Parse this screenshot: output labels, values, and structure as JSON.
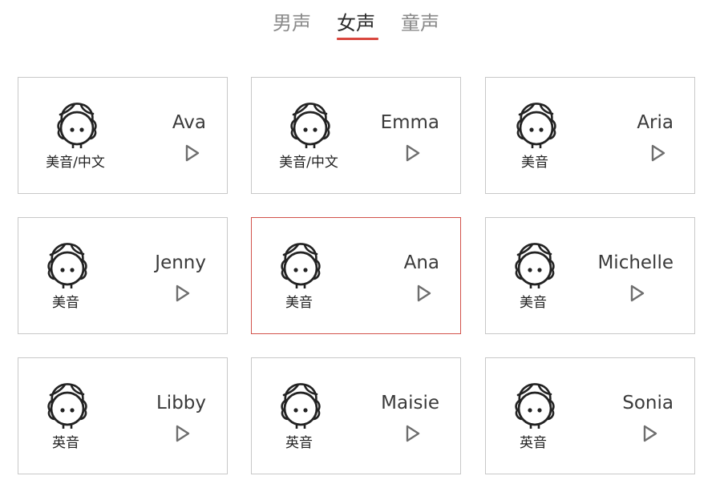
{
  "tabs": [
    {
      "label": "男声",
      "active": false
    },
    {
      "label": "女声",
      "active": true
    },
    {
      "label": "童声",
      "active": false
    }
  ],
  "colors": {
    "accent": "#d9473f",
    "card_border": "#c8c8c8",
    "selected_border": "#d2524b",
    "icon": "#222222",
    "play_icon": "#6e6e6e"
  },
  "icons": {
    "avatar": "girl-face-icon",
    "play": "play-triangle-icon"
  },
  "voices": [
    {
      "name": "Ava",
      "accent": "美音/中文",
      "selected": false
    },
    {
      "name": "Emma",
      "accent": "美音/中文",
      "selected": false
    },
    {
      "name": "Aria",
      "accent": "美音",
      "selected": false
    },
    {
      "name": "Jenny",
      "accent": "美音",
      "selected": false
    },
    {
      "name": "Ana",
      "accent": "美音",
      "selected": true
    },
    {
      "name": "Michelle",
      "accent": "美音",
      "selected": false
    },
    {
      "name": "Libby",
      "accent": "英音",
      "selected": false
    },
    {
      "name": "Maisie",
      "accent": "英音",
      "selected": false
    },
    {
      "name": "Sonia",
      "accent": "英音",
      "selected": false
    }
  ]
}
